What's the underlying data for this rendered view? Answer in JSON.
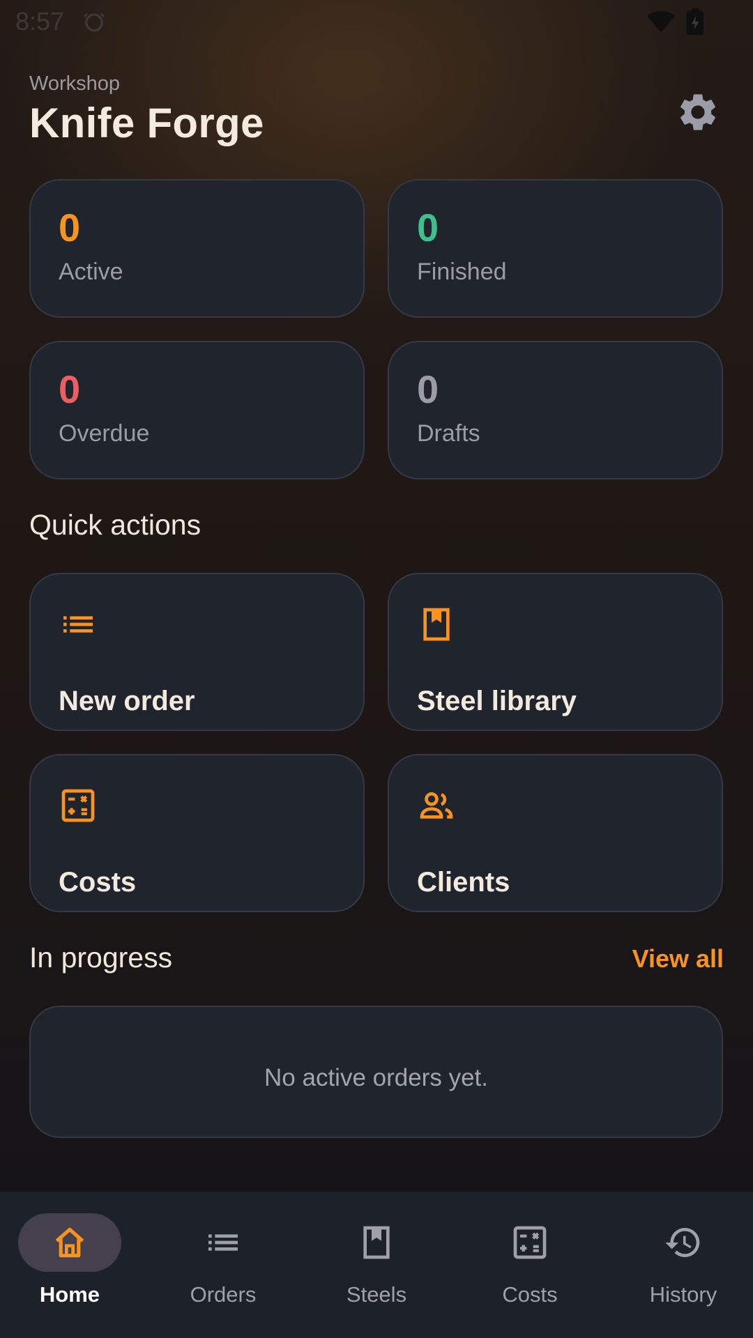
{
  "status_bar": {
    "time": "8:57",
    "icons": [
      "alarm-icon",
      "wifi-icon",
      "battery-icon"
    ]
  },
  "header": {
    "eyebrow": "Workshop",
    "title": "Knife Forge",
    "settings_icon": "gear-icon"
  },
  "stats": [
    {
      "value": "0",
      "label": "Active",
      "color": "#f7931e"
    },
    {
      "value": "0",
      "label": "Finished",
      "color": "#3fbf8a"
    },
    {
      "value": "0",
      "label": "Overdue",
      "color": "#ef5d62"
    },
    {
      "value": "0",
      "label": "Drafts",
      "color": "#9a9da8"
    }
  ],
  "quick_actions": {
    "title": "Quick actions",
    "items": [
      {
        "label": "New order",
        "icon": "list-icon"
      },
      {
        "label": "Steel library",
        "icon": "book-icon"
      },
      {
        "label": "Costs",
        "icon": "calculator-icon"
      },
      {
        "label": "Clients",
        "icon": "people-icon"
      }
    ]
  },
  "in_progress": {
    "title": "In progress",
    "view_all": "View all",
    "empty_message": "No active orders yet."
  },
  "bottom_nav": {
    "items": [
      {
        "label": "Home",
        "icon": "home-icon",
        "active": true
      },
      {
        "label": "Orders",
        "icon": "list-icon",
        "active": false
      },
      {
        "label": "Steels",
        "icon": "book-icon",
        "active": false
      },
      {
        "label": "Costs",
        "icon": "calculator-icon",
        "active": false
      },
      {
        "label": "History",
        "icon": "history-icon",
        "active": false
      }
    ]
  },
  "colors": {
    "accent": "#f7931e",
    "card_bg": "#20242c",
    "nav_bg": "#1d212a",
    "active_pill": "#45404d"
  }
}
